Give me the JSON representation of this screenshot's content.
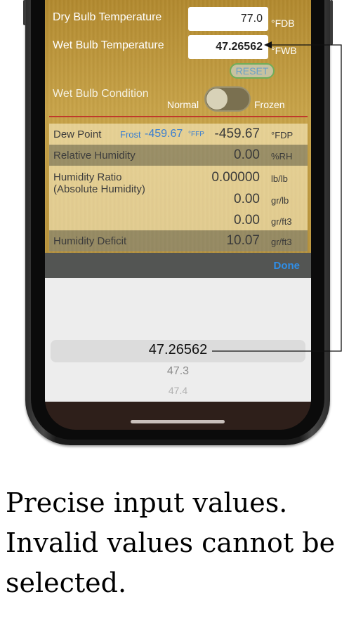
{
  "inputs": {
    "dry_bulb": {
      "label": "Dry Bulb Temperature",
      "value": "77.0",
      "unit": "°FDB"
    },
    "wet_bulb": {
      "label": "Wet Bulb Temperature",
      "value": "47.26562",
      "unit": "°FWB"
    },
    "reset_label": "RESET",
    "condition": {
      "label": "Wet Bulb Condition",
      "left": "Normal",
      "right": "Frozen"
    }
  },
  "results": {
    "dew_point": {
      "label": "Dew Point",
      "frost_label": "Frost",
      "frost_value": "-459.67",
      "frost_unit": "°FFP",
      "value": "-459.67",
      "unit": "°FDP"
    },
    "relative_humidity": {
      "label": "Relative Humidity",
      "value": "0.00",
      "unit": "%RH"
    },
    "humidity_ratio": {
      "label": "Humidity Ratio",
      "label2": "(Absolute Humidity)",
      "value": "0.00000",
      "unit": "lb/lb",
      "value2": "0.00",
      "unit2": "gr/lb",
      "value3": "0.00",
      "unit3": "gr/ft3"
    },
    "humidity_deficit": {
      "label": "Humidity Deficit",
      "value": "10.07",
      "unit": "gr/ft3"
    }
  },
  "toolbar": {
    "done_label": "Done"
  },
  "picker": {
    "selected": "47.26562",
    "next1": "47.3",
    "next2": "47.4"
  },
  "caption": {
    "line1": "Precise input values.",
    "line2": "Invalid values cannot be",
    "line3": "selected."
  },
  "colors": {
    "accent": "#2f8ee8",
    "frost": "#3b7fd0",
    "reset_border": "#6fae5a",
    "divider": "#c0392b"
  }
}
